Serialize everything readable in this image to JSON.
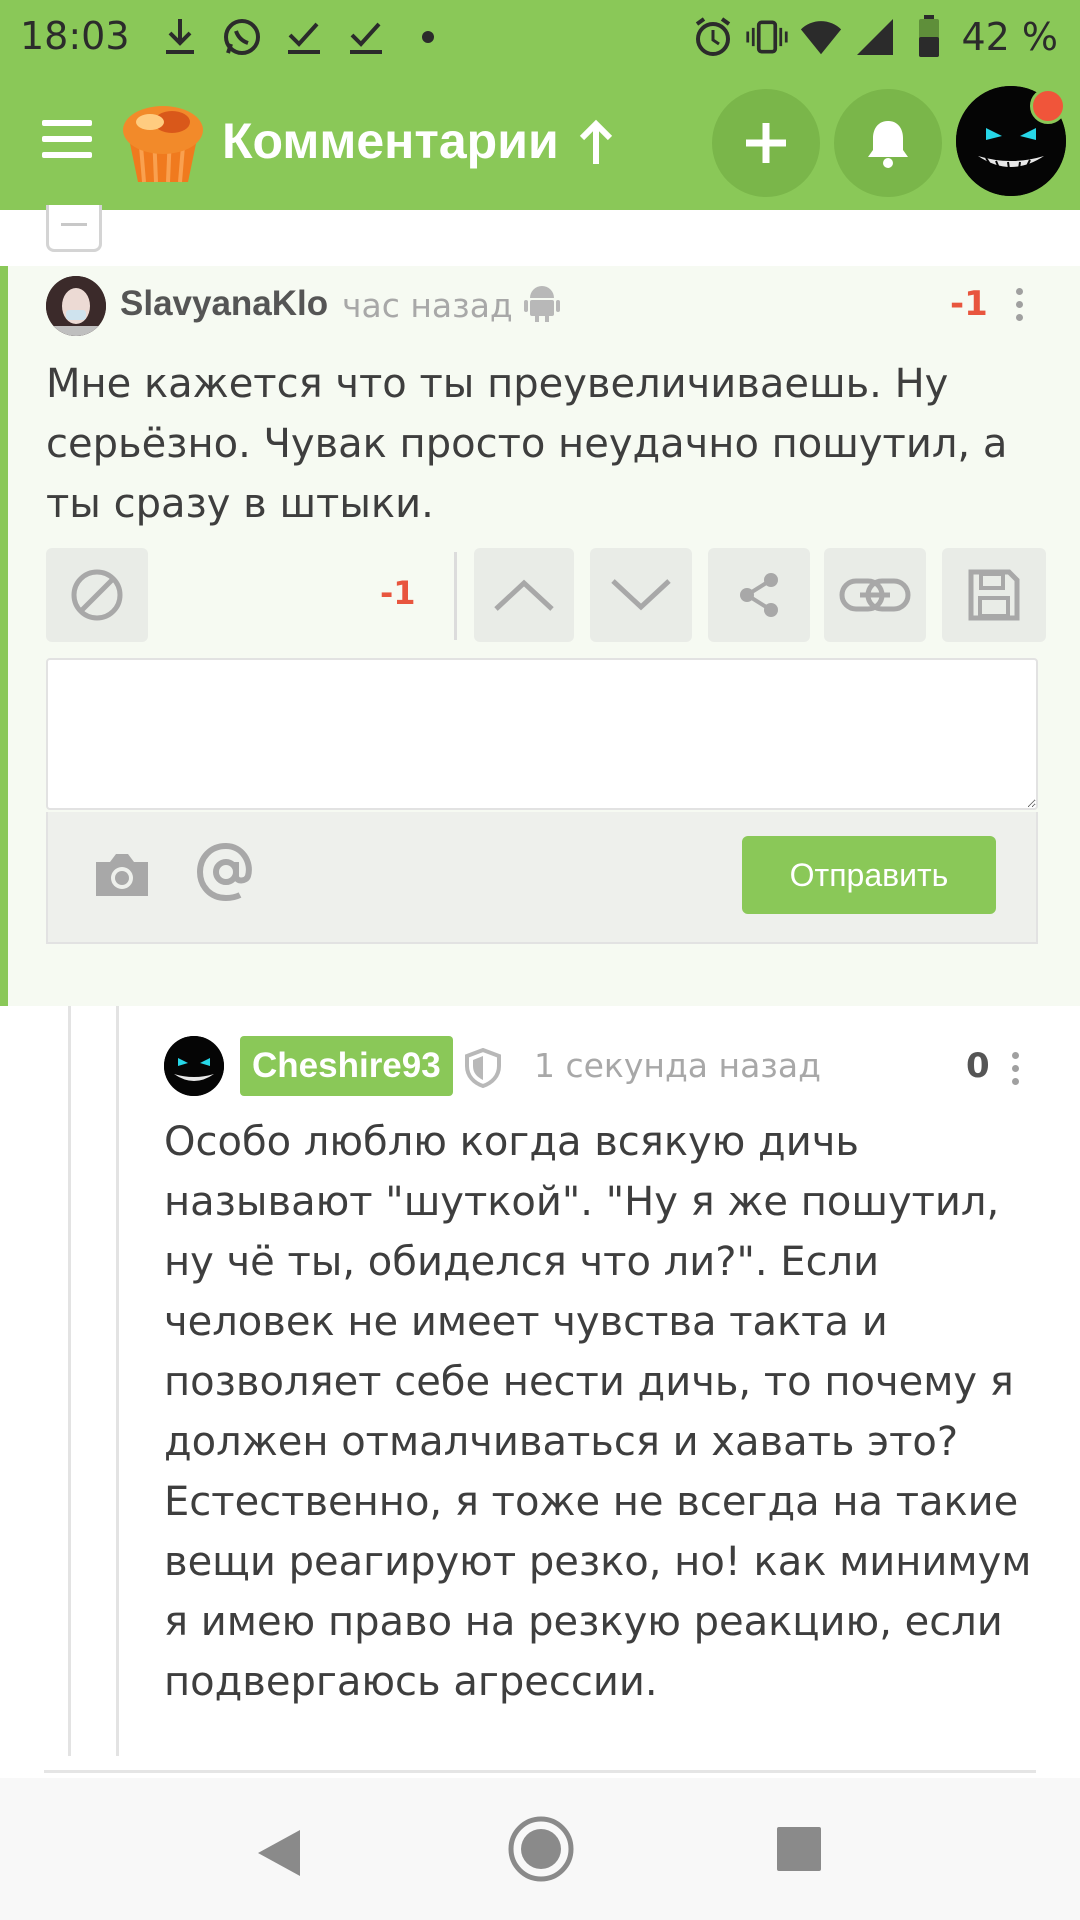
{
  "status_bar": {
    "time": "18:03",
    "battery_percent": "42 %",
    "left_icons": [
      "download-icon",
      "whatsapp-icon",
      "check-icon",
      "check-icon",
      "dot-icon"
    ],
    "right_icons": [
      "alarm-icon",
      "vibrate-icon",
      "wifi-icon",
      "signal-icon",
      "battery-icon"
    ]
  },
  "app_bar": {
    "title": "Комментарии",
    "menu_icon": "hamburger-icon",
    "logo_icon": "pikabu-logo",
    "sort_icon": "arrow-up-icon",
    "add_icon": "plus-icon",
    "notifications_icon": "bell-icon",
    "accent_color": "#8ac858",
    "notification_dot_color": "#f0553a"
  },
  "comment_1": {
    "username": "SlavyanaKlo",
    "time": "час назад",
    "platform_icon": "android-icon",
    "rating": "-1",
    "text": "Мне кажется что ты преувеличиваешь. Ну серьёзно. Чувак просто неудачно пошутил, а ты сразу в штыки.",
    "toolbar": {
      "score": "-1",
      "icons": [
        "block-icon",
        "upvote-icon",
        "downvote-icon",
        "share-icon",
        "link-icon",
        "save-icon"
      ]
    },
    "reply": {
      "input_value": "",
      "send_label": "Отправить",
      "icons": [
        "camera-icon",
        "at-icon"
      ]
    }
  },
  "comment_2": {
    "username": "Cheshire93",
    "time": "1 секунда назад",
    "rating": "0",
    "text": "Особо люблю когда всякую дичь называют \"шуткой\". \"Ну я же пошутил, ну чё ты, обиделся что ли?\". Если человек не имеет чувства такта и позволяет себе нести дичь, то почему я должен отмалчиваться и хавать это? Естественно, я тоже не всегда на такие вещи реагируют резко, но! как минимум я имею право на резкую реакцию, если подвергаюсь агрессии."
  },
  "nav_bar": {
    "icons": [
      "back-icon",
      "home-icon",
      "recents-icon"
    ]
  }
}
